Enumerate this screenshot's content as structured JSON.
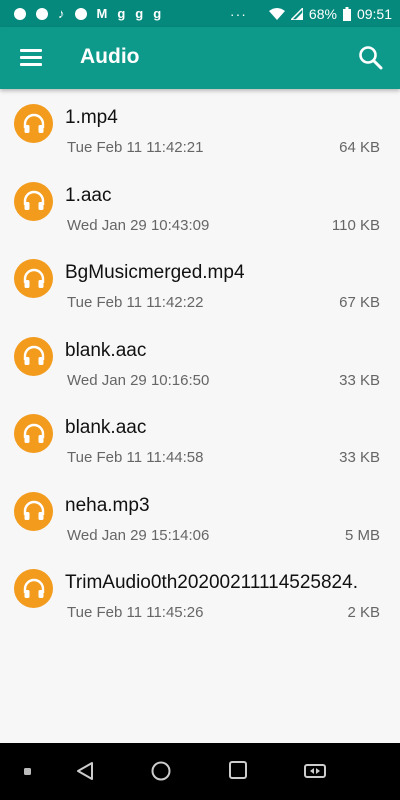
{
  "status_bar": {
    "battery": "68%",
    "time": "09:51",
    "overflow": "···",
    "left_icons": [
      "app-icon",
      "facebook-icon",
      "tiktok-icon",
      "facebook-icon",
      "m-app-icon",
      "g-icon",
      "g-icon",
      "g-icon"
    ]
  },
  "app_bar": {
    "title": "Audio",
    "menu_icon": "hamburger-menu-icon",
    "search_icon": "search-icon"
  },
  "colors": {
    "status_bar": "#06897d",
    "app_bar": "#0e9a8b",
    "accent": "#f29b1d",
    "background": "#f7f7f7"
  },
  "files": [
    {
      "name": "1.mp4",
      "date": "Tue Feb 11 11:42:21",
      "size": "64 KB"
    },
    {
      "name": "1.aac",
      "date": "Wed Jan 29 10:43:09",
      "size": "110 KB"
    },
    {
      "name": "BgMusicmerged.mp4",
      "date": "Tue Feb 11 11:42:22",
      "size": "67 KB"
    },
    {
      "name": "blank.aac",
      "date": "Wed Jan 29 10:16:50",
      "size": "33 KB"
    },
    {
      "name": "blank.aac",
      "date": "Tue Feb 11 11:44:58",
      "size": "33 KB"
    },
    {
      "name": "neha.mp3",
      "date": "Wed Jan 29 15:14:06",
      "size": "5 MB"
    },
    {
      "name": "TrimAudio0th20200211114525824.",
      "date": "Tue Feb 11 11:45:26",
      "size": "2 KB"
    }
  ],
  "nav_bar": {
    "icons": [
      "dot-icon",
      "back-icon",
      "home-icon",
      "recents-icon",
      "switch-icon"
    ]
  }
}
